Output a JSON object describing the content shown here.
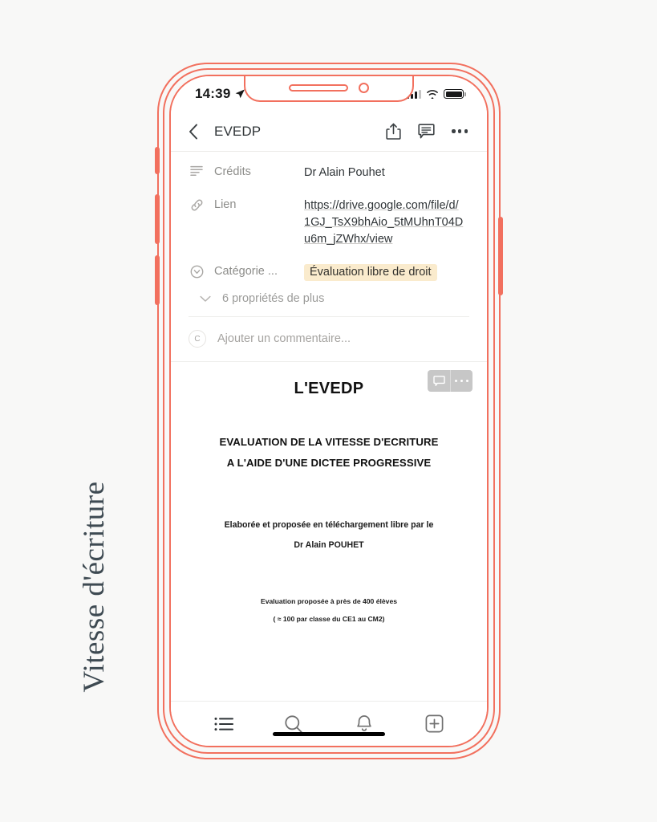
{
  "caption": {
    "text": "Vitesse d'écriture"
  },
  "status_bar": {
    "time": "14:39",
    "location_icon": "location-arrow-icon",
    "signal_icon": "cellular-signal-icon",
    "wifi_icon": "wifi-icon",
    "battery_icon": "battery-full-icon"
  },
  "nav_bar": {
    "back_icon": "chevron-left-icon",
    "title": "EVEDP",
    "share_icon": "share-icon",
    "comment_icon": "comment-icon",
    "more_icon": "more-horizontal-icon"
  },
  "properties": [
    {
      "icon": "text-lines-icon",
      "label": "Crédits",
      "value": "Dr Alain Pouhet",
      "type": "text"
    },
    {
      "icon": "link-icon",
      "label": "Lien",
      "value": "https://drive.google.com/file/d/1GJ_TsX9bhAio_5tMUhnT04Du6m_jZWhx/view",
      "type": "link"
    },
    {
      "icon": "select-circle-icon",
      "label": "Catégorie ...",
      "value": "Évaluation libre de droit",
      "type": "tag",
      "tag_color": "#faebcd"
    }
  ],
  "more_properties": {
    "icon": "chevron-down-icon",
    "label": "6 propriétés de plus"
  },
  "comment": {
    "avatar_initial": "C",
    "placeholder": "Ajouter un commentaire..."
  },
  "document": {
    "toolbar": {
      "comment_icon": "comment-icon",
      "more_icon": "more-horizontal-icon"
    },
    "title": "L'EVEDP",
    "heading_line1": "EVALUATION DE LA VITESSE D'ECRITURE",
    "heading_line2": "A L'AIDE D'UNE DICTEE PROGRESSIVE",
    "author_line1": "Elaborée et proposée en téléchargement libre par le",
    "author_line2": "Dr Alain POUHET",
    "note_line1": "Evaluation proposée à près de  400 élèves",
    "note_line2": "( ≈ 100 par classe du CE1 au CM2)"
  },
  "tab_bar": {
    "items": [
      {
        "icon": "list-icon",
        "name": "tab-list",
        "active": true
      },
      {
        "icon": "search-icon",
        "name": "tab-search",
        "active": false
      },
      {
        "icon": "bell-icon",
        "name": "tab-notifications",
        "active": false
      },
      {
        "icon": "plus-square-icon",
        "name": "tab-new",
        "active": false
      }
    ]
  },
  "colors": {
    "frame": "#f2705e",
    "page_background": "#f8f8f7",
    "tag_background": "#faebcd",
    "caption_text": "#3e4a52"
  }
}
